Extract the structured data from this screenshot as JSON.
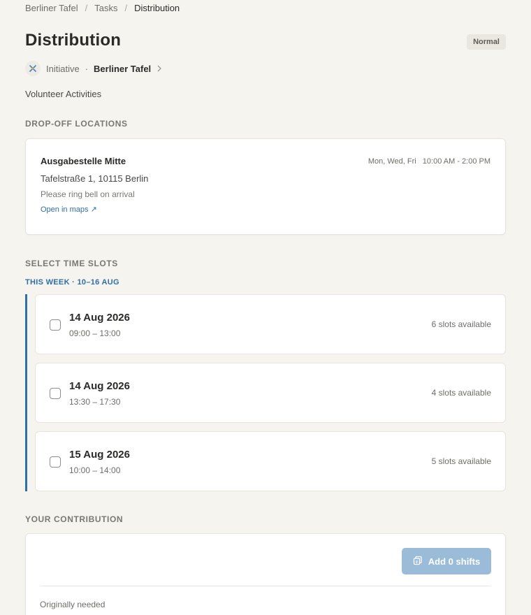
{
  "breadcrumb": {
    "items": [
      "Berliner Tafel",
      "Tasks"
    ],
    "current": "Distribution",
    "separator": "/"
  },
  "task": {
    "title": "Distribution",
    "priority": "Normal",
    "type": "Initiative",
    "org_name": "Berliner Tafel",
    "category": "Volunteer Activities"
  },
  "dropoff": {
    "heading": "DROP-OFF LOCATIONS",
    "location": {
      "name": "Ausgabestelle Mitte",
      "days": "Mon, Wed, Fri",
      "hours": "10:00 AM - 2:00 PM",
      "address": "Tafelstraße 1, 10115 Berlin",
      "note": "Please ring bell on arrival",
      "map_link": "Open in maps ↗"
    }
  },
  "slots": {
    "heading": "SELECT TIME SLOTS",
    "week_label": "THIS WEEK · 10–16 AUG",
    "items": [
      {
        "date": "14 Aug 2026",
        "time": "09:00 – 13:00",
        "available": "6 slots available"
      },
      {
        "date": "14 Aug 2026",
        "time": "13:30 – 17:30",
        "available": "4 slots available"
      },
      {
        "date": "15 Aug 2026",
        "time": "10:00 – 14:00",
        "available": "5 slots available"
      }
    ]
  },
  "contribution": {
    "heading": "YOUR CONTRIBUTION",
    "add_button": "Add 0 shifts",
    "original_label": "Originally needed"
  },
  "colors": {
    "accent": "#2f6fa8",
    "button_disabled": "#9bbcd8",
    "background": "#f5f4ef"
  },
  "icons": {
    "org_logo": "berliner-tafel-logo",
    "chevron": "chevron-right-icon",
    "add": "copy-icon"
  }
}
